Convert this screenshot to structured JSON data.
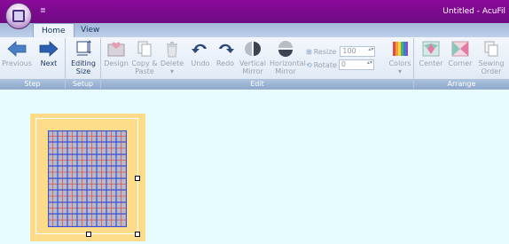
{
  "titlebar": {
    "quick_access": "≣",
    "title": "Untitled - AcuFil"
  },
  "tabs": [
    {
      "label": "Home",
      "active": true
    },
    {
      "label": "View",
      "active": false
    }
  ],
  "ribbon": {
    "groups": [
      {
        "label": "Step"
      },
      {
        "label": "Setup"
      },
      {
        "label": "Edit"
      },
      {
        "label": "Arrange"
      }
    ],
    "step": {
      "previous": "Previous",
      "next": "Next"
    },
    "setup": {
      "editing_size_line1": "Editing",
      "editing_size_line2": "Size"
    },
    "edit": {
      "design": "Design",
      "copy_paste_line1": "Copy &",
      "copy_paste_line2": "Paste",
      "delete": "Delete",
      "undo": "Undo",
      "redo": "Redo",
      "vmirror_line1": "Vertical",
      "vmirror_line2": "Mirror",
      "hmirror_line1": "Horizontal",
      "hmirror_line2": "Mirror",
      "resize_label": "Resize",
      "resize_value": "100",
      "rotate_label": "Rotate",
      "rotate_value": "0",
      "colors": "Colors"
    },
    "arrange": {
      "center": "Center",
      "corner": "Corner",
      "sewing_line1": "Sewing",
      "sewing_line2": "Order"
    }
  },
  "colors": {
    "title_bar": "#7a0a8e",
    "quilt_backing": "#fddc89",
    "grid_blue": "#3b4fd6",
    "grid_red": "#e0524a"
  }
}
